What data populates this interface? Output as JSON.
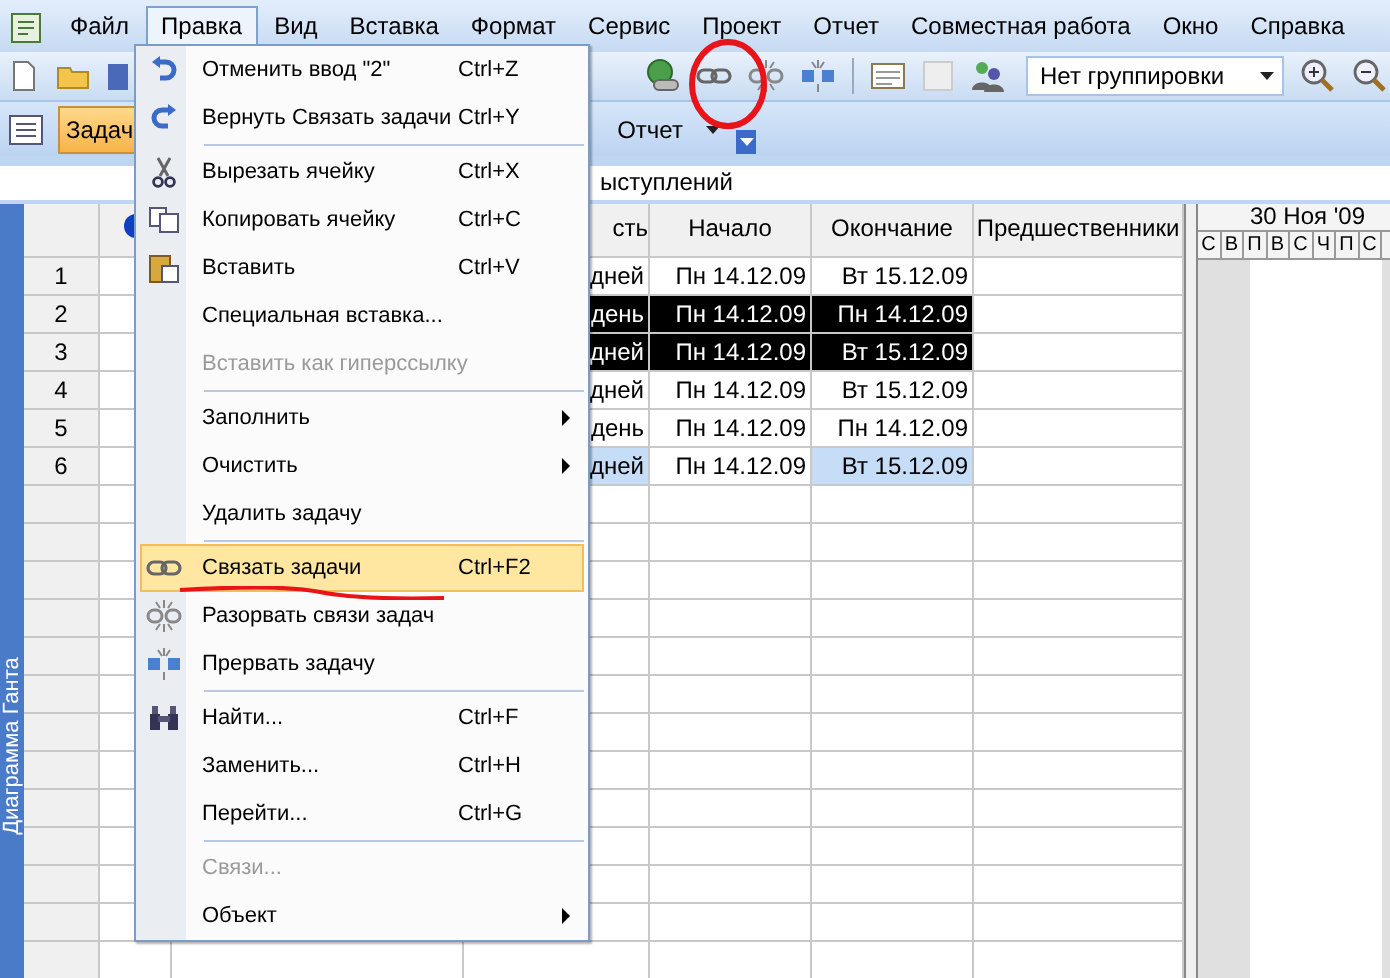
{
  "menubar": {
    "items": [
      {
        "label": "Файл",
        "selected": false
      },
      {
        "label": "Правка",
        "selected": true
      },
      {
        "label": "Вид",
        "selected": false
      },
      {
        "label": "Вставка",
        "selected": false
      },
      {
        "label": "Формат",
        "selected": false
      },
      {
        "label": "Сервис",
        "selected": false
      },
      {
        "label": "Проект",
        "selected": false
      },
      {
        "label": "Отчет",
        "selected": false
      },
      {
        "label": "Совместная работа",
        "selected": false
      },
      {
        "label": "Окно",
        "selected": false
      },
      {
        "label": "Справка",
        "selected": false
      }
    ]
  },
  "toolbar": {
    "grouping": {
      "value": "Нет группировки"
    }
  },
  "view_bar": {
    "tabs": [
      {
        "label": "Задач",
        "selected": true
      },
      {
        "label": "Отчет",
        "selected": false
      }
    ]
  },
  "entry_bar": {
    "value": "ыступлений"
  },
  "side_tab": {
    "label": "Диаграмма Ганта"
  },
  "table": {
    "columns": [
      "сть",
      "Начало",
      "Окончание",
      "Предшественники"
    ],
    "rows": [
      {
        "number": "1",
        "cells": [
          {
            "text": "дней",
            "selected": false,
            "changed": false
          },
          {
            "text": "Пн 14.12.09",
            "selected": false,
            "changed": false
          },
          {
            "text": "Вт 15.12.09",
            "selected": false,
            "changed": false
          }
        ]
      },
      {
        "number": "2",
        "cells": [
          {
            "text": "день",
            "selected": true,
            "changed": false
          },
          {
            "text": "Пн 14.12.09",
            "selected": true,
            "changed": false
          },
          {
            "text": "Пн 14.12.09",
            "selected": true,
            "changed": false
          }
        ]
      },
      {
        "number": "3",
        "cells": [
          {
            "text": "дней",
            "selected": true,
            "changed": false
          },
          {
            "text": "Пн 14.12.09",
            "selected": true,
            "changed": false
          },
          {
            "text": "Вт 15.12.09",
            "selected": true,
            "changed": false
          }
        ]
      },
      {
        "number": "4",
        "cells": [
          {
            "text": "дней",
            "selected": false,
            "changed": false
          },
          {
            "text": "Пн 14.12.09",
            "selected": false,
            "changed": false
          },
          {
            "text": "Вт 15.12.09",
            "selected": false,
            "changed": false
          }
        ]
      },
      {
        "number": "5",
        "cells": [
          {
            "text": "день",
            "selected": false,
            "changed": false
          },
          {
            "text": "Пн 14.12.09",
            "selected": false,
            "changed": false
          },
          {
            "text": "Пн 14.12.09",
            "selected": false,
            "changed": false
          }
        ]
      },
      {
        "number": "6",
        "cells": [
          {
            "text": "дней",
            "selected": false,
            "changed": true
          },
          {
            "text": "Пн 14.12.09",
            "selected": false,
            "changed": false
          },
          {
            "text": "Вт 15.12.09",
            "selected": false,
            "changed": true
          }
        ]
      }
    ]
  },
  "gantt": {
    "date": "30 Ноя '09",
    "days": [
      "С",
      "В",
      "П",
      "В",
      "С",
      "Ч",
      "П",
      "С"
    ]
  },
  "edit_menu": {
    "items": [
      {
        "kind": "item",
        "label": "Отменить ввод \"2\"",
        "shortcut": "Ctrl+Z",
        "disabled": false,
        "selected": false
      },
      {
        "kind": "item",
        "label": "Вернуть Связать задачи",
        "shortcut": "Ctrl+Y",
        "disabled": false,
        "selected": false
      },
      {
        "kind": "separator"
      },
      {
        "kind": "item",
        "label": "Вырезать ячейку",
        "shortcut": "Ctrl+X",
        "disabled": false,
        "selected": false
      },
      {
        "kind": "item",
        "label": "Копировать ячейку",
        "shortcut": "Ctrl+C",
        "disabled": false,
        "selected": false
      },
      {
        "kind": "item",
        "label": "Вставить",
        "shortcut": "Ctrl+V",
        "disabled": false,
        "selected": false
      },
      {
        "kind": "item",
        "label": "Специальная вставка...",
        "disabled": false,
        "selected": false
      },
      {
        "kind": "item",
        "label": "Вставить как гиперссылку",
        "disabled": true,
        "selected": false
      },
      {
        "kind": "separator"
      },
      {
        "kind": "submenu",
        "label": "Заполнить",
        "disabled": false,
        "selected": false
      },
      {
        "kind": "submenu",
        "label": "Очистить",
        "disabled": false,
        "selected": false
      },
      {
        "kind": "item",
        "label": "Удалить задачу",
        "disabled": false,
        "selected": false
      },
      {
        "kind": "separator"
      },
      {
        "kind": "item",
        "label": "Связать задачи",
        "shortcut": "Ctrl+F2",
        "disabled": false,
        "selected": true
      },
      {
        "kind": "item",
        "label": "Разорвать связи задач",
        "disabled": false,
        "selected": false
      },
      {
        "kind": "item",
        "label": "Прервать задачу",
        "disabled": false,
        "selected": false
      },
      {
        "kind": "separator"
      },
      {
        "kind": "item",
        "label": "Найти...",
        "shortcut": "Ctrl+F",
        "disabled": false,
        "selected": false
      },
      {
        "kind": "item",
        "label": "Заменить...",
        "shortcut": "Ctrl+H",
        "disabled": false,
        "selected": false
      },
      {
        "kind": "item",
        "label": "Перейти...",
        "shortcut": "Ctrl+G",
        "disabled": false,
        "selected": false
      },
      {
        "kind": "separator"
      },
      {
        "kind": "item",
        "label": "Связи...",
        "disabled": true,
        "selected": false
      },
      {
        "kind": "submenu",
        "label": "Объект",
        "disabled": false,
        "selected": false
      }
    ]
  }
}
